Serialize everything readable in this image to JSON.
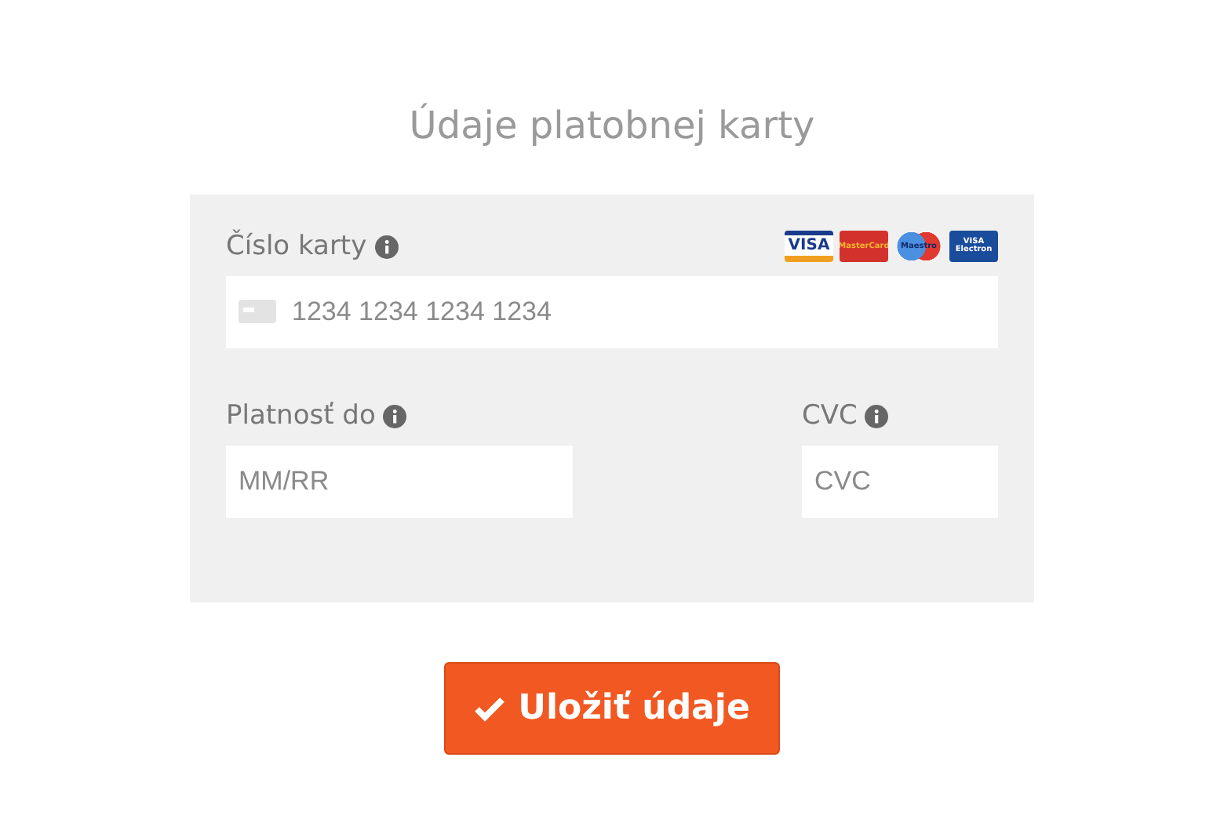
{
  "title": "Údaje platobnej karty",
  "card_logos": [
    {
      "kind": "visa",
      "label": "VISA"
    },
    {
      "kind": "mastercard",
      "label": "MasterCard"
    },
    {
      "kind": "maestro",
      "label": "Maestro"
    },
    {
      "kind": "electron",
      "label": "VISA Electron"
    }
  ],
  "card_number": {
    "label": "Číslo karty",
    "placeholder": "1234 1234 1234 1234"
  },
  "expiry": {
    "label": "Platnosť do",
    "placeholder": "MM/RR"
  },
  "cvc": {
    "label": "CVC",
    "placeholder": "CVC"
  },
  "submit_button": {
    "label": "Uložiť údaje"
  }
}
